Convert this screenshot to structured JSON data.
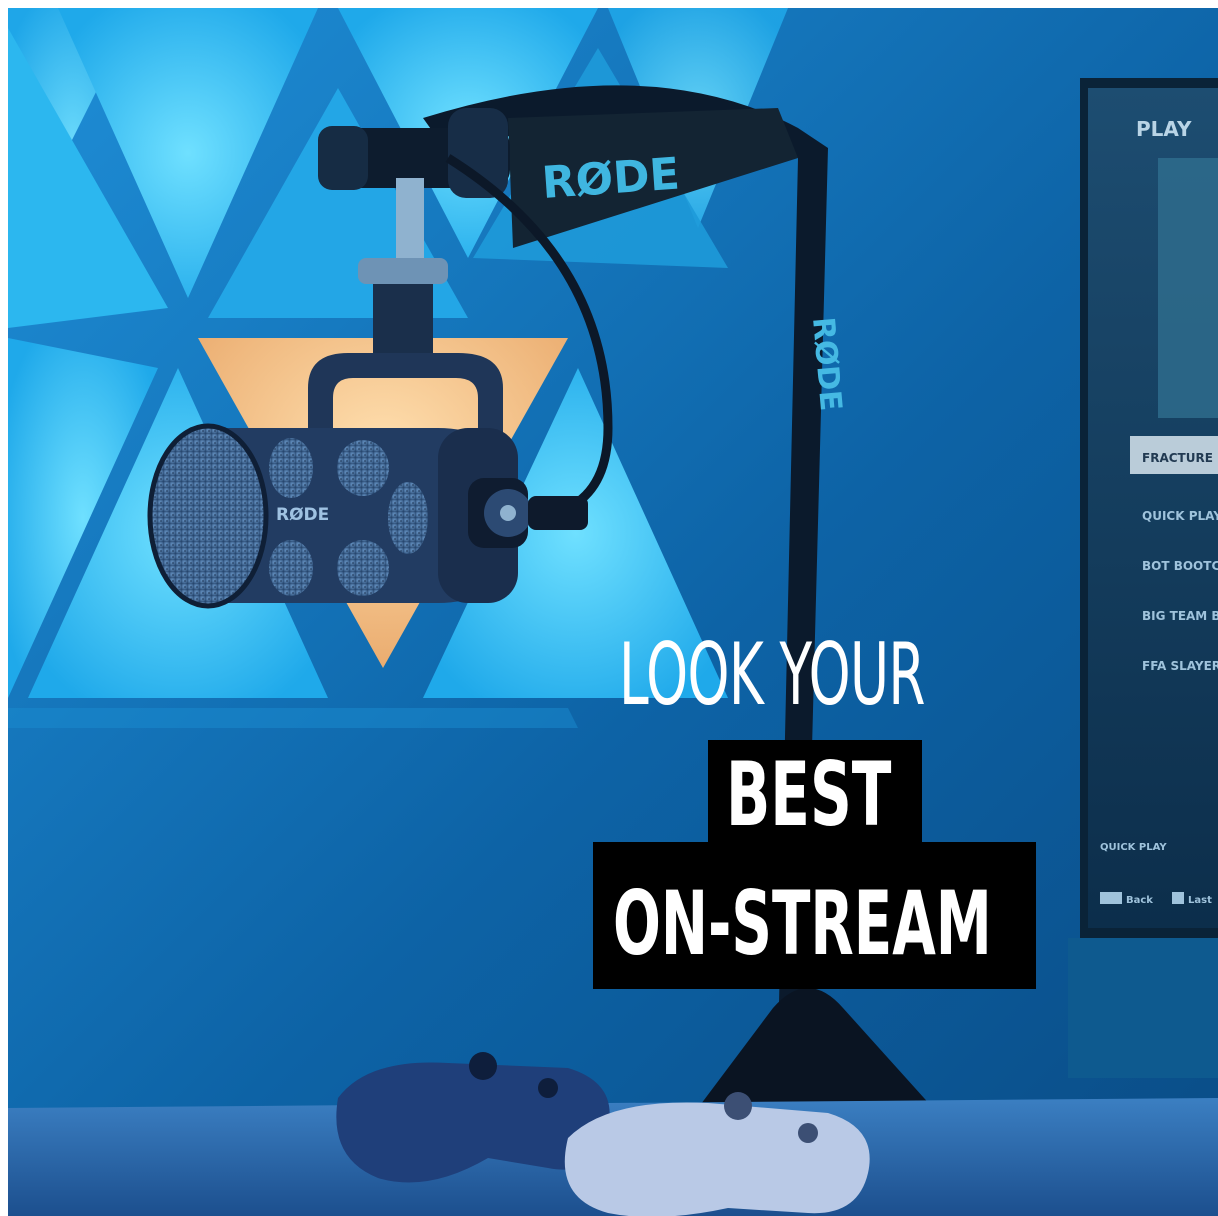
{
  "brand": {
    "arm_logo": "RØDE",
    "mic_logo": "RØDE",
    "arm_side_logo": "RØDE"
  },
  "headline": {
    "line1": "LOOK YOUR",
    "line2": "BEST",
    "line3": "ON-STREAM"
  },
  "monitor": {
    "title": "PLAY",
    "menu_items": [
      "FRACTURE",
      "QUICK PLAY",
      "BOT BOOTCA",
      "BIG TEAM BA",
      "FFA SLAYER"
    ],
    "footer_item": "QUICK PLAY",
    "footer_keys": [
      "Back",
      "Last"
    ]
  },
  "colors": {
    "wall": "#0b5f9e",
    "panel_light": "#35c3f5",
    "panel_warm": "#f3c283",
    "caption_box": "#000000",
    "caption_text": "#ffffff"
  }
}
